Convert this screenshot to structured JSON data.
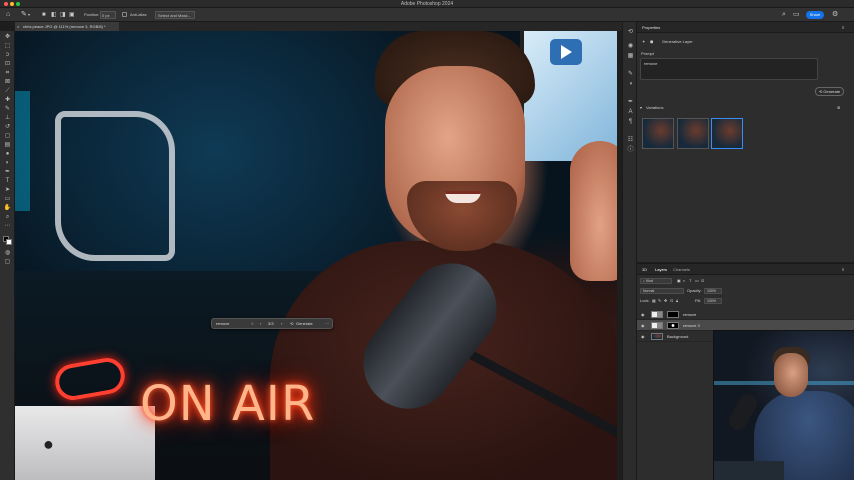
{
  "app": {
    "window_title": "Adobe Photoshop 2024",
    "colors": {
      "accent": "#1473e6",
      "panel": "#2d2d2d",
      "canvas_bg": "#1e1e1e"
    }
  },
  "options_bar": {
    "position_label": "Position:",
    "position_value": "0 px",
    "anti_alias_label": "Anti-alias",
    "select_mask_label": "Select and Mask...",
    "share_label": "Share"
  },
  "document": {
    "tab_title": "chris peace.JPG @ 111% (remove 3, RGB/8) *"
  },
  "contextual_taskbar": {
    "prompt_value": "remove",
    "variation_counter": "3/3",
    "generate_label": "Generate",
    "more_label": "···"
  },
  "properties": {
    "panel_title": "Properties",
    "layer_type": "Generative Layer",
    "prompt_label": "Prompt",
    "prompt_value": "remove",
    "generate_label": "Generate",
    "variations_label": "Variations",
    "variation_count": 3,
    "selected_variation": 3
  },
  "layers": {
    "tabs": [
      "3D",
      "Layers",
      "Channels"
    ],
    "active_tab": "Layers",
    "filter_label": "Kind",
    "blend_mode": "Normal",
    "opacity_label": "Opacity:",
    "opacity_value": "100%",
    "lock_label": "Lock:",
    "fill_label": "Fill:",
    "fill_value": "100%",
    "items": [
      {
        "name": "remove",
        "selected": false
      },
      {
        "name": "remove 3",
        "selected": true
      },
      {
        "name": "Background",
        "selected": false
      }
    ]
  },
  "canvas": {
    "neon_sign_text": "ON AIR",
    "neon_sign_left": "AIR"
  }
}
